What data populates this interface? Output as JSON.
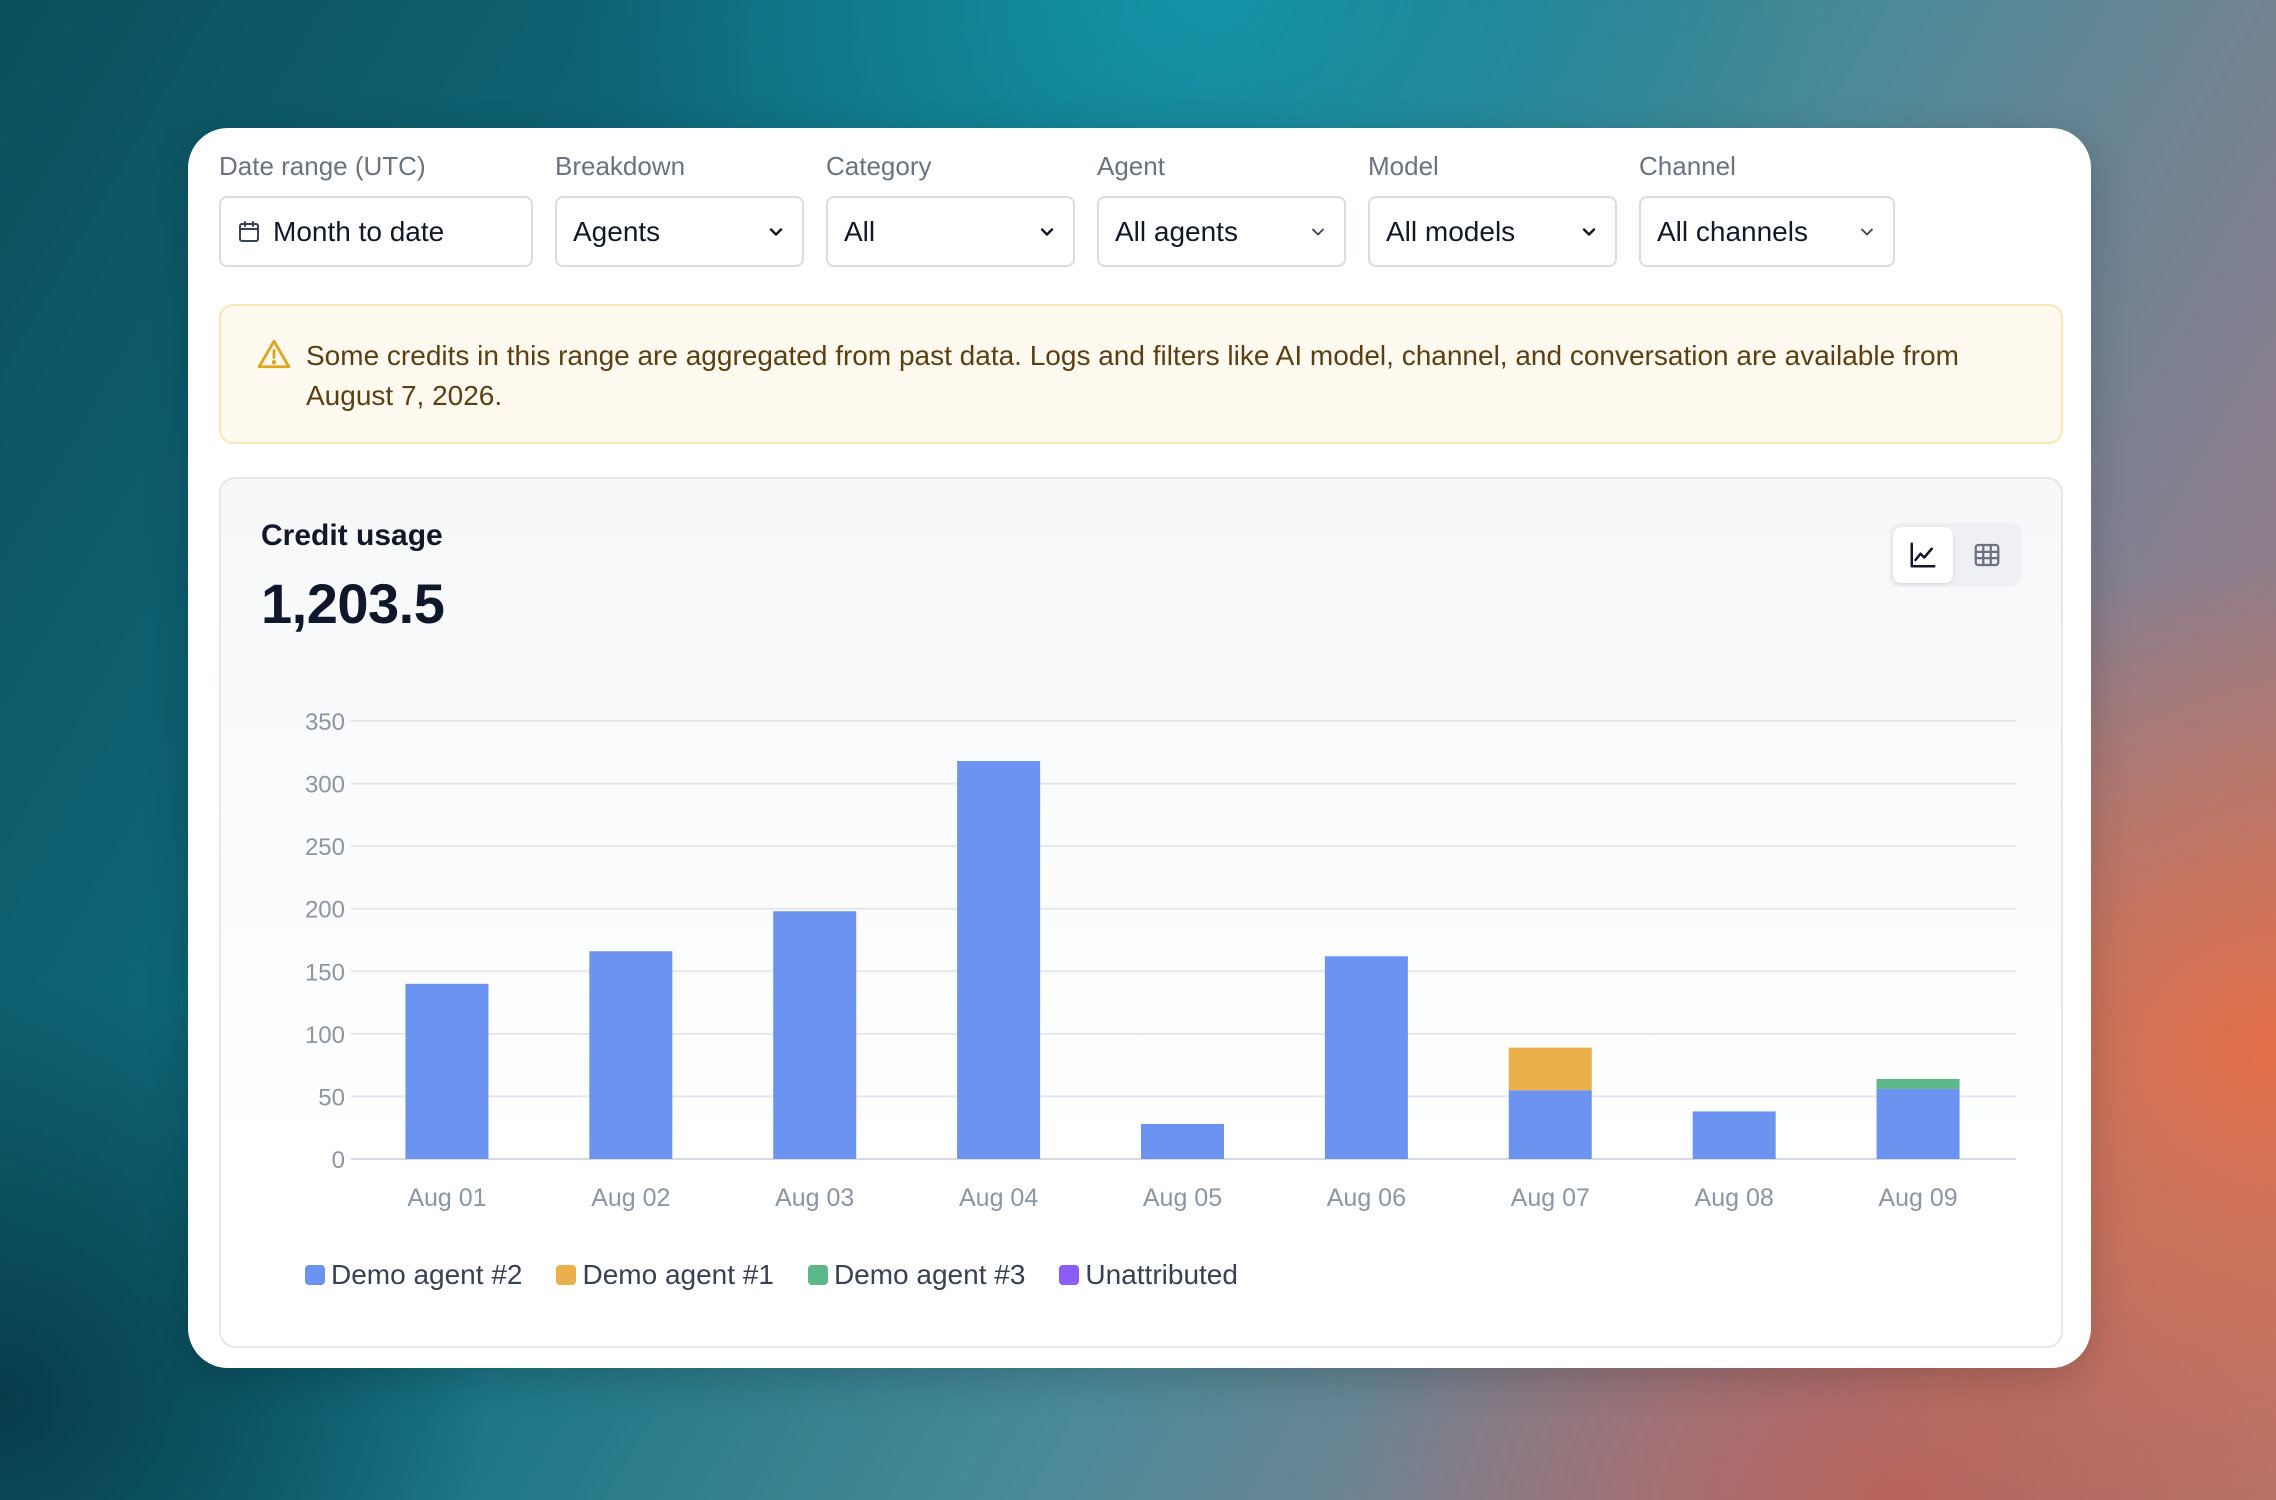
{
  "filters": {
    "date_range": {
      "label": "Date range (UTC)",
      "value": "Month to date"
    },
    "breakdown": {
      "label": "Breakdown",
      "value": "Agents"
    },
    "category": {
      "label": "Category",
      "value": "All"
    },
    "agent": {
      "label": "Agent",
      "value": "All agents"
    },
    "model": {
      "label": "Model",
      "value": "All models"
    },
    "channel": {
      "label": "Channel",
      "value": "All channels"
    }
  },
  "notice": {
    "text": "Some credits in this range are aggregated from past data. Logs and filters like AI model, channel, and conversation are available from August 7, 2026."
  },
  "chart": {
    "title": "Credit usage",
    "total": "1,203.5",
    "views": [
      "chart",
      "table"
    ],
    "active_view": "chart"
  },
  "colors": {
    "demo_agent_2": "#6b93ef",
    "demo_agent_1": "#ebb04c",
    "demo_agent_3": "#5cb888",
    "unattributed": "#8b5cf6"
  },
  "chart_data": {
    "type": "bar",
    "stacked": true,
    "categories": [
      "Aug 01",
      "Aug 02",
      "Aug 03",
      "Aug 04",
      "Aug 05",
      "Aug 06",
      "Aug 07",
      "Aug 08",
      "Aug 09"
    ],
    "series": [
      {
        "name": "Demo agent #2",
        "color": "#6b93ef",
        "values": [
          140,
          166,
          198,
          318,
          28,
          162,
          55,
          38,
          56
        ]
      },
      {
        "name": "Demo agent #1",
        "color": "#ebb04c",
        "values": [
          0,
          0,
          0,
          0,
          0,
          0,
          34,
          0,
          0
        ]
      },
      {
        "name": "Demo agent #3",
        "color": "#5cb888",
        "values": [
          0,
          0,
          0,
          0,
          0,
          0,
          0,
          0,
          8
        ]
      },
      {
        "name": "Unattributed",
        "color": "#8b5cf6",
        "values": [
          0,
          0,
          0,
          0,
          0,
          0,
          0,
          0,
          0
        ]
      }
    ],
    "yticks": [
      0,
      50,
      100,
      150,
      200,
      250,
      300,
      350
    ],
    "ylim": [
      0,
      350
    ],
    "grid": true,
    "legend_position": "bottom-left"
  }
}
